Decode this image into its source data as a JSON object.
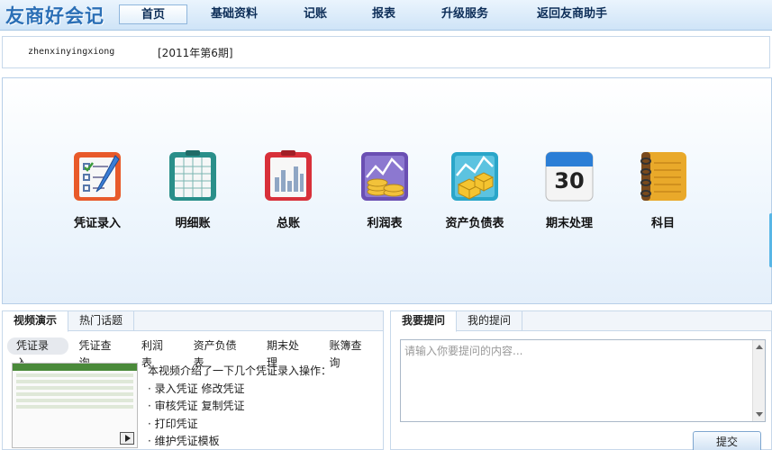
{
  "app": {
    "logo": "友商好会记"
  },
  "nav": {
    "items": [
      "首页",
      "基础资料",
      "记账",
      "报表",
      "升级服务",
      "返回友商助手"
    ],
    "active_index": 0
  },
  "user": {
    "username": "zhenxinyingxiong",
    "period": "[2011年第6期]"
  },
  "functions": {
    "tiles": [
      {
        "label": "凭证录入",
        "icon": "voucher-entry-icon"
      },
      {
        "label": "明细账",
        "icon": "detail-ledger-icon"
      },
      {
        "label": "总账",
        "icon": "general-ledger-icon"
      },
      {
        "label": "利润表",
        "icon": "profit-statement-icon"
      },
      {
        "label": "资产负债表",
        "icon": "balance-sheet-icon"
      },
      {
        "label": "期末处理",
        "icon": "calendar-icon",
        "icon_text": "30"
      },
      {
        "label": "科目",
        "icon": "notebook-icon"
      }
    ]
  },
  "video_panel": {
    "tabs": [
      "视频演示",
      "热门话题"
    ],
    "active_tab": 0,
    "subtabs": [
      "凭证录入",
      "凭证查询",
      "利润表",
      "资产负债表",
      "期末处理",
      "账簿查询"
    ],
    "active_subtab": 0,
    "intro": "本视频介绍了一下几个凭证录入操作：",
    "items": [
      "录入凭证 修改凭证",
      "审核凭证 复制凭证",
      "打印凭证",
      "维护凭证模板"
    ]
  },
  "question_panel": {
    "tabs": [
      "我要提问",
      "我的提问"
    ],
    "active_tab": 0,
    "placeholder": "请输入你要提问的内容...",
    "submit_label": "提交"
  },
  "colors": {
    "nav_bg": "#cfe4f7",
    "logo": "#2b6fb6",
    "accent": "#58b6e6"
  }
}
